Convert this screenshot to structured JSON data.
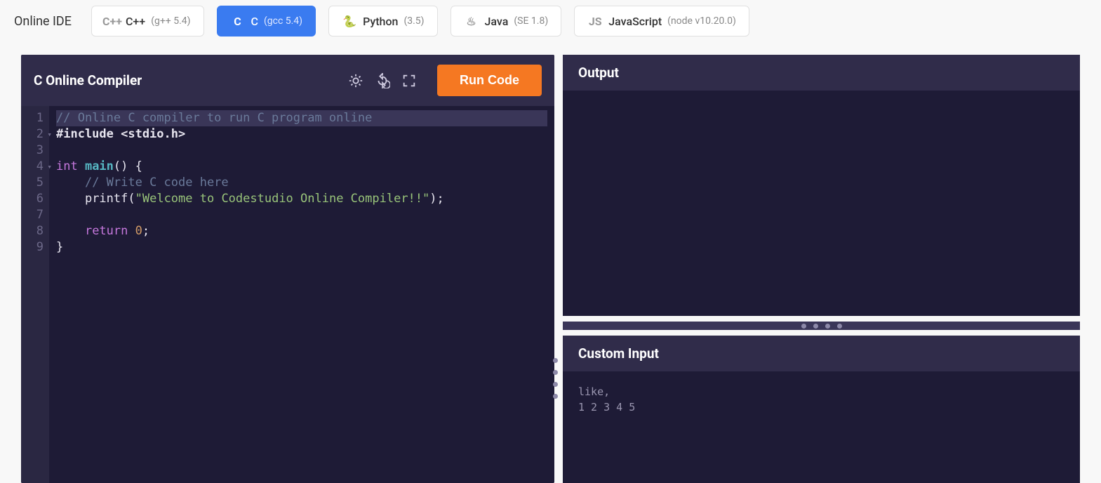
{
  "brand": "Online IDE",
  "languages": [
    {
      "id": "cpp",
      "icon": "C++",
      "name": "C++",
      "version": "(g++ 5.4)",
      "active": false
    },
    {
      "id": "c",
      "icon": "C",
      "name": "C",
      "version": "(gcc 5.4)",
      "active": true
    },
    {
      "id": "python",
      "icon": "🐍",
      "name": "Python",
      "version": "(3.5)",
      "active": false
    },
    {
      "id": "java",
      "icon": "♨",
      "name": "Java",
      "version": "(SE 1.8)",
      "active": false
    },
    {
      "id": "js",
      "icon": "JS",
      "name": "JavaScript",
      "version": "(node v10.20.0)",
      "active": false
    }
  ],
  "editor": {
    "title": "C Online Compiler",
    "run_label": "Run Code"
  },
  "code": {
    "lines": [
      {
        "n": 1,
        "hl": true,
        "tokens": [
          {
            "cls": "tok-comment",
            "t": "// Online C compiler to run C program online"
          }
        ]
      },
      {
        "n": 2,
        "fold": true,
        "tokens": [
          {
            "cls": "tok-preproc",
            "t": "#include <stdio.h>"
          }
        ]
      },
      {
        "n": 3,
        "tokens": []
      },
      {
        "n": 4,
        "fold": true,
        "tokens": [
          {
            "cls": "tok-type",
            "t": "int "
          },
          {
            "cls": "tok-main",
            "t": "main"
          },
          {
            "cls": "tok-punc",
            "t": "() {"
          }
        ]
      },
      {
        "n": 5,
        "tokens": [
          {
            "cls": "",
            "t": "    "
          },
          {
            "cls": "tok-comment",
            "t": "// Write C code here"
          }
        ]
      },
      {
        "n": 6,
        "tokens": [
          {
            "cls": "",
            "t": "    "
          },
          {
            "cls": "tok-call",
            "t": "printf"
          },
          {
            "cls": "tok-punc",
            "t": "("
          },
          {
            "cls": "tok-str",
            "t": "\"Welcome to Codestudio Online Compiler!!\""
          },
          {
            "cls": "tok-punc",
            "t": ");"
          }
        ]
      },
      {
        "n": 7,
        "tokens": []
      },
      {
        "n": 8,
        "tokens": [
          {
            "cls": "",
            "t": "    "
          },
          {
            "cls": "tok-kw",
            "t": "return "
          },
          {
            "cls": "tok-num",
            "t": "0"
          },
          {
            "cls": "tok-punc",
            "t": ";"
          }
        ]
      },
      {
        "n": 9,
        "tokens": [
          {
            "cls": "tok-punc",
            "t": "}"
          }
        ]
      }
    ]
  },
  "output": {
    "title": "Output",
    "content": ""
  },
  "input": {
    "title": "Custom Input",
    "content": "like,\n1 2 3 4 5"
  }
}
